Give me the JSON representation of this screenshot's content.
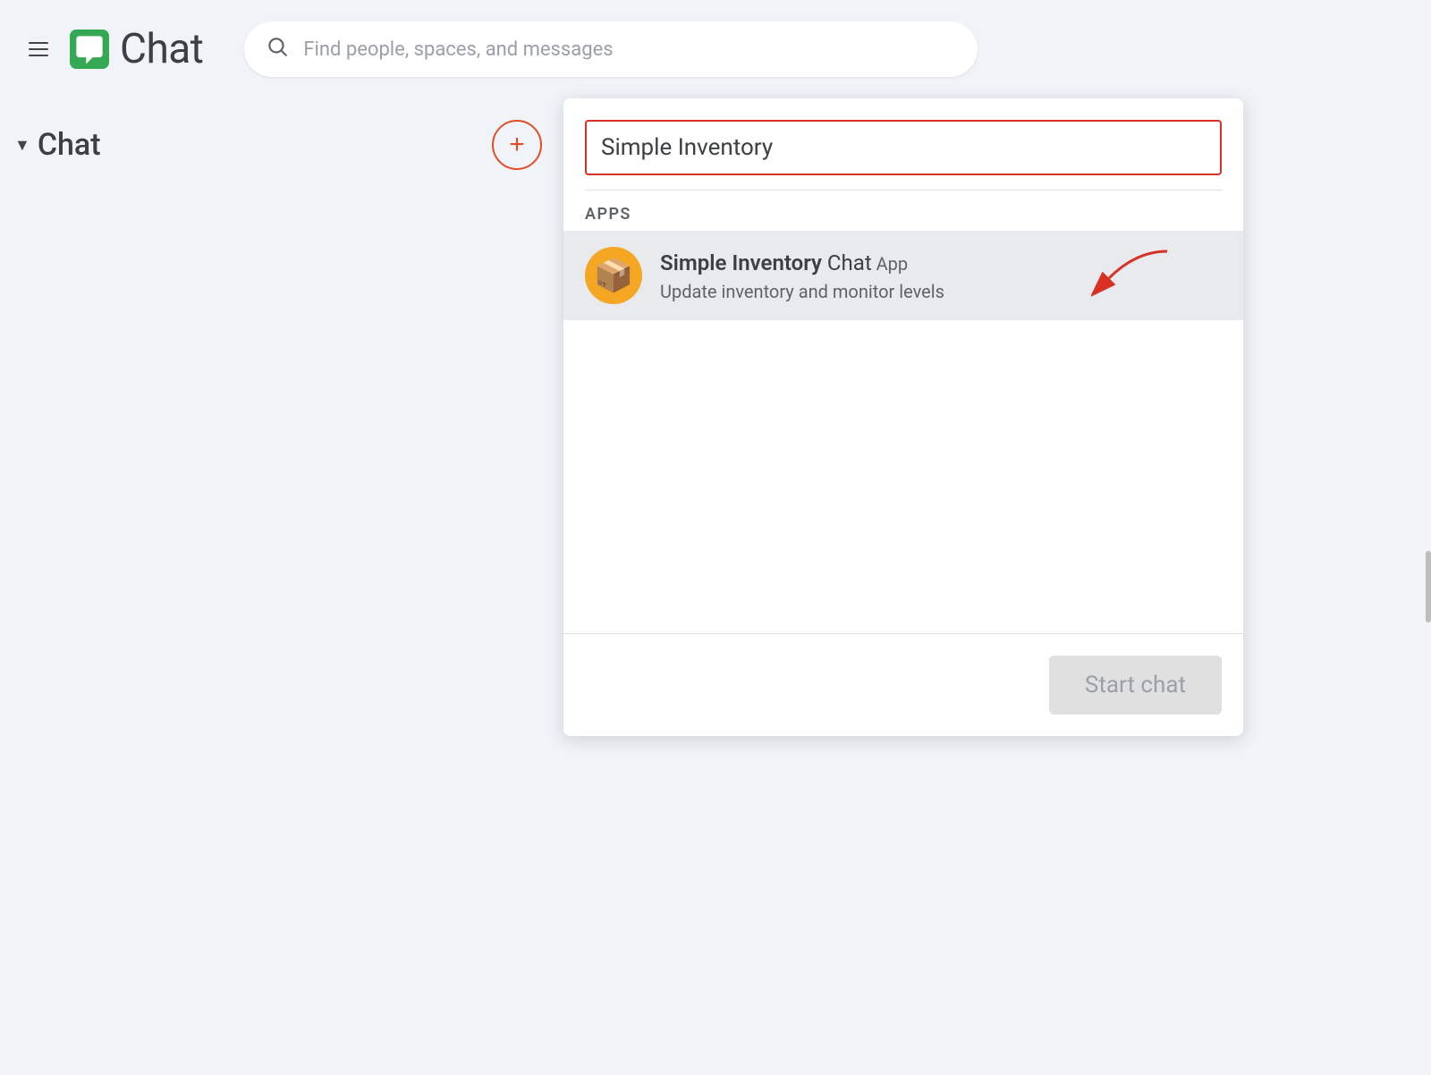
{
  "header": {
    "hamburger_label": "Menu",
    "app_title": "Chat",
    "search_placeholder": "Find people, spaces, and messages"
  },
  "sidebar": {
    "chat_section_label": "Chat",
    "add_button_label": "+"
  },
  "dropdown": {
    "search_value": "Simple Inventory",
    "apps_section_label": "APPS",
    "result": {
      "name_bold": "Simple Inventory",
      "name_suffix": " Chat",
      "badge": "  App",
      "subtitle": "Update inventory and monitor levels",
      "icon_emoji": "📦"
    },
    "start_chat_button": "Start chat"
  }
}
